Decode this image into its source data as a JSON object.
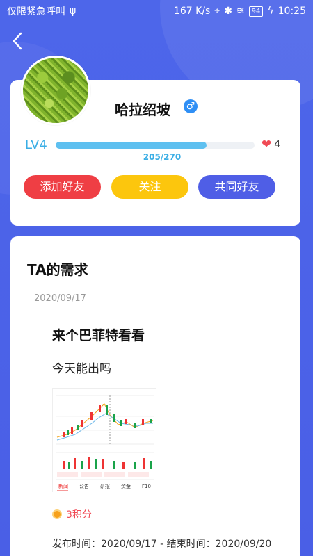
{
  "status_bar": {
    "left_text": "仅限紧急呼叫",
    "usb_icon": "usb-icon",
    "speed": "167 K/s",
    "battery": "94",
    "time": "10:25"
  },
  "profile": {
    "name": "哈拉绍坡",
    "gender_symbol": "♂",
    "level": "LV4",
    "progress_text": "205/270",
    "progress_current": 205,
    "progress_max": 270,
    "likes": "4",
    "buttons": {
      "add_friend": "添加好友",
      "follow": "关注",
      "mutual_friends": "共同好友"
    }
  },
  "needs": {
    "section_title": "TA的需求",
    "date": "2020/09/17",
    "post": {
      "title": "来个巴菲特看看",
      "description": "今天能出吗",
      "reward": "3积分",
      "dates_text": "发布时间：2020/09/17 - 结束时间：2020/09/20"
    },
    "image_tabs": [
      "新闻",
      "公告",
      "研报",
      "资金",
      "F10"
    ]
  },
  "colors": {
    "header_blue": "#4a63e7",
    "add_friend": "#ef3e44",
    "follow": "#fcc60d",
    "mutual": "#4f5ee6",
    "progress": "#5ec0f0"
  }
}
